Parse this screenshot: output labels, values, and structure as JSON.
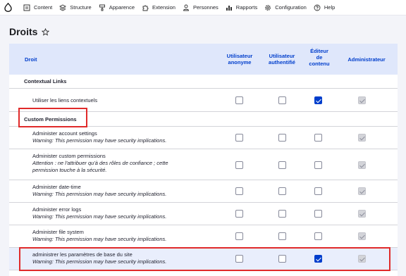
{
  "toolbar": {
    "items": [
      {
        "label": "Content",
        "icon": "document-icon"
      },
      {
        "label": "Structure",
        "icon": "structure-icon"
      },
      {
        "label": "Apparence",
        "icon": "paint-icon"
      },
      {
        "label": "Extension",
        "icon": "puzzle-icon"
      },
      {
        "label": "Personnes",
        "icon": "person-icon"
      },
      {
        "label": "Rapports",
        "icon": "chart-icon"
      },
      {
        "label": "Configuration",
        "icon": "gear-icon"
      },
      {
        "label": "Help",
        "icon": "help-icon"
      }
    ]
  },
  "page": {
    "title": "Droits"
  },
  "table": {
    "headers": {
      "droit": "Droit",
      "anon_1": "Utilisateur",
      "anon_2": "anonyme",
      "auth_1": "Utilisateur",
      "auth_2": "authentifié",
      "editor_1": "Éditeur",
      "editor_2": "de",
      "editor_3": "contenu",
      "admin": "Administrateur"
    },
    "rows": [
      {
        "type": "group",
        "title": "Contextual Links"
      },
      {
        "type": "perm",
        "title": "Utiliser les liens contextuels",
        "anon": false,
        "auth": false,
        "editor": true,
        "admin": true
      },
      {
        "type": "group",
        "title": "Custom Permissions"
      },
      {
        "type": "perm",
        "title": "Administer account settings",
        "desc": "Warning: This permission may have security implications.",
        "anon": false,
        "auth": false,
        "editor": false,
        "admin": true
      },
      {
        "type": "perm",
        "title": "Administer custom permissions",
        "desc1": "Attention : ne l'attribuer qu'à des rôles de confiance ; cette",
        "desc2": "permission touche à la sécurité.",
        "anon": false,
        "auth": false,
        "editor": false,
        "admin": true
      },
      {
        "type": "perm",
        "title": "Administer date-time",
        "desc": "Warning: This permission may have security implications.",
        "anon": false,
        "auth": false,
        "editor": false,
        "admin": true
      },
      {
        "type": "perm",
        "title": "Administer error logs",
        "desc": "Warning: This permission may have security implications.",
        "anon": false,
        "auth": false,
        "editor": false,
        "admin": true
      },
      {
        "type": "perm",
        "title": "Administer file system",
        "desc": "Warning: This permission may have security implications.",
        "anon": false,
        "auth": false,
        "editor": false,
        "admin": true
      },
      {
        "type": "perm",
        "title": "administrer les paramètres de base du site",
        "desc": "Warning: This permission may have security implications.",
        "anon": false,
        "auth": false,
        "editor": true,
        "admin": true
      }
    ]
  },
  "colors": {
    "accent": "#003ecc",
    "highlight": "#e02a2a",
    "header_bg": "#dfe7fb"
  }
}
